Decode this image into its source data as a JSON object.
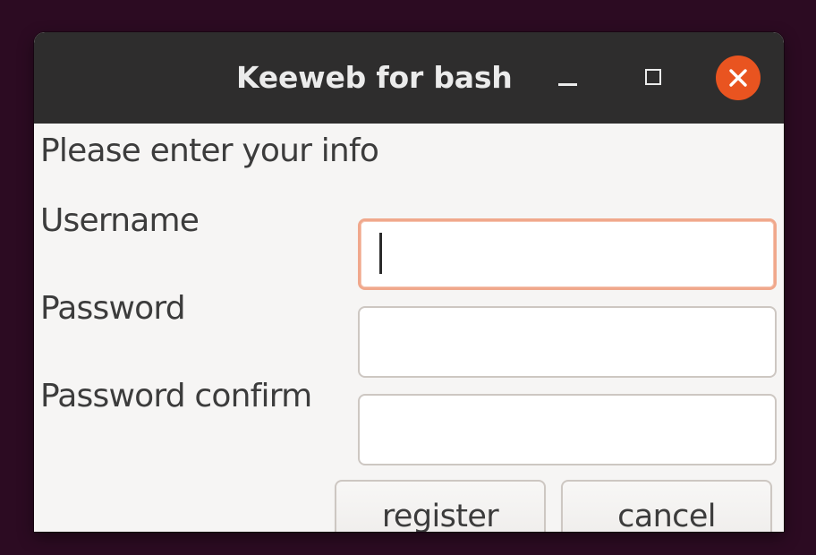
{
  "window": {
    "title": "Keeweb for bash",
    "controls": {
      "minimize_icon": "minimize-icon",
      "maximize_icon": "maximize-icon",
      "close_icon": "close-icon",
      "close_color": "#e95420"
    }
  },
  "form": {
    "prompt": "Please enter your info",
    "fields": [
      {
        "label": "Username",
        "value": "",
        "placeholder": "",
        "focused": true
      },
      {
        "label": "Password",
        "value": "",
        "placeholder": "",
        "focused": false
      },
      {
        "label": "Password confirm",
        "value": "",
        "placeholder": "",
        "focused": false
      }
    ],
    "focus_color": "#f0a88c"
  },
  "buttons": {
    "register_label": "register",
    "cancel_label": "cancel"
  }
}
